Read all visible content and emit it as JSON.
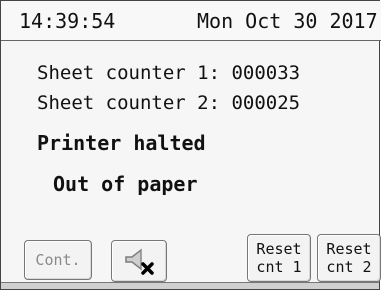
{
  "header": {
    "time": "14:39:54",
    "date": "Mon Oct 30 2017"
  },
  "counters": [
    {
      "label": "Sheet counter 1:",
      "value": "000033"
    },
    {
      "label": "Sheet counter 2:",
      "value": "000025"
    }
  ],
  "status": {
    "primary": "Printer halted",
    "secondary": "Out of paper"
  },
  "buttons": {
    "continue_label": "Cont.",
    "mute_icon": "speaker-muted-icon",
    "reset_1_line_1": "Reset",
    "reset_1_line_2": "cnt 1",
    "reset_2_line_1": "Reset",
    "reset_2_line_2": "cnt 2"
  },
  "colors": {
    "disabled_text": "#8a8a8a",
    "mute_x": "#000000"
  }
}
